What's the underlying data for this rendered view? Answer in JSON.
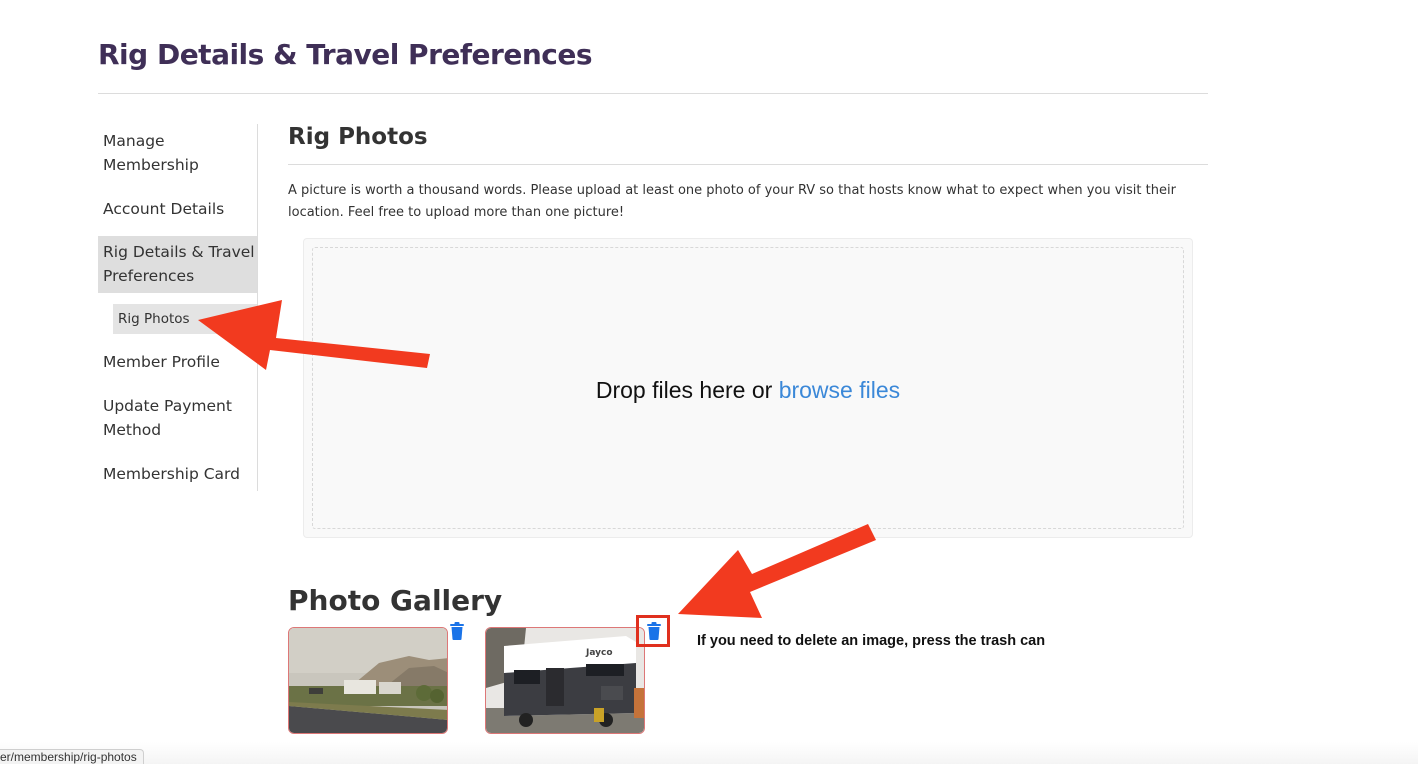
{
  "header": {
    "title": "Rig Details & Travel Preferences"
  },
  "sidebar": {
    "items": [
      {
        "label": "Manage Membership"
      },
      {
        "label": "Account Details"
      },
      {
        "label": "Rig Details & Travel Preferences"
      },
      {
        "label": "Member Profile"
      },
      {
        "label": "Update Payment Method"
      },
      {
        "label": "Membership Card"
      }
    ],
    "subitem": {
      "label": "Rig Photos"
    }
  },
  "main": {
    "section_title": "Rig Photos",
    "intro": "A picture is worth a thousand words. Please upload at least one photo of your RV so that hosts know what to expect when you visit their location. Feel free to upload more than one picture!",
    "dropzone": {
      "prefix": "Drop files here or ",
      "link": "browse files"
    },
    "gallery": {
      "title": "Photo Gallery",
      "photos": [
        {
          "subject": "roadside landscape with RVs and hills"
        },
        {
          "subject": "Jayco travel trailer",
          "brand_text": "Jayco"
        }
      ],
      "delete_icon": "trash-icon",
      "note": "If you need to delete an image, press the trash can"
    }
  },
  "status_bar": {
    "url": "er/membership/rig-photos"
  },
  "colors": {
    "title": "#3f2f57",
    "link": "#3b88d8",
    "trash": "#1a73e8",
    "annotation": "#e0301e"
  }
}
